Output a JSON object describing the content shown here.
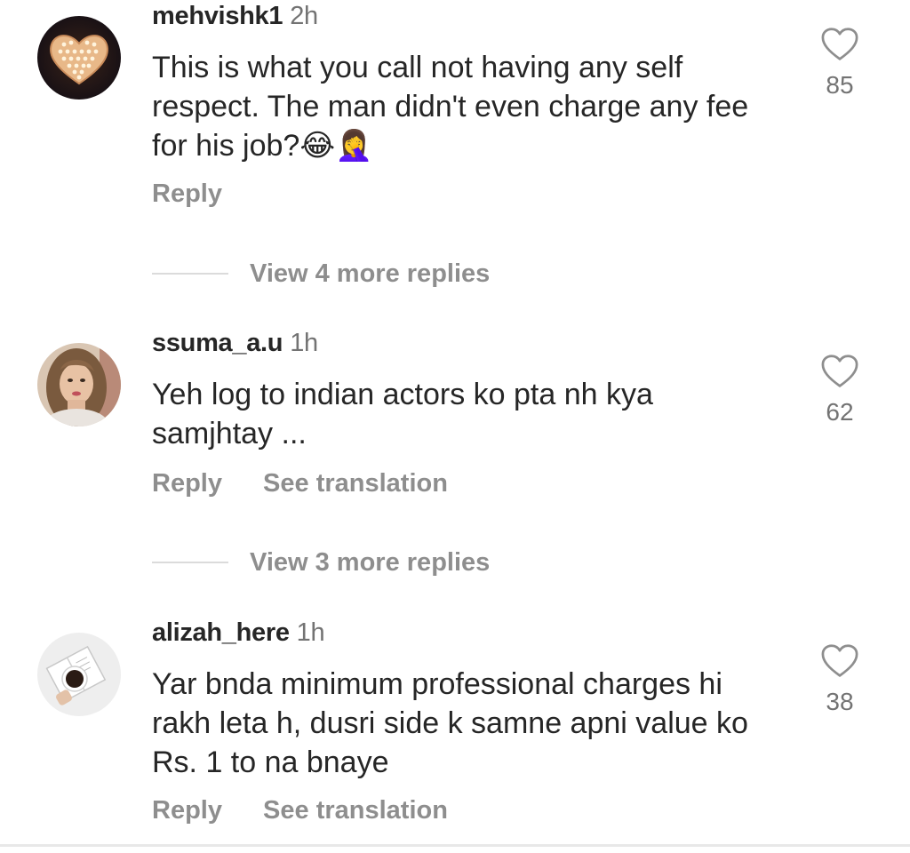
{
  "comments": [
    {
      "username": "mehvishk1",
      "time": "2h",
      "text": "This is what you call not having any self respect. The man didn't even charge any fee for his job?😂🤦‍♀️",
      "likes": "85",
      "actions": {
        "reply": "Reply"
      },
      "view_replies": "View 4 more replies",
      "avatar_icon": "heart-marquee-lights"
    },
    {
      "username": "ssuma_a.u",
      "time": "1h",
      "text": "Yeh log to indian actors ko pta nh kya samjhtay ...",
      "likes": "62",
      "actions": {
        "reply": "Reply",
        "translate": "See translation"
      },
      "view_replies": "View 3 more replies",
      "avatar_icon": "woman-portrait"
    },
    {
      "username": "alizah_here",
      "time": "1h",
      "text": "Yar bnda minimum professional charges hi rakh leta h, dusri side k samne apni value ko Rs. 1 to na bnaye",
      "likes": "38",
      "actions": {
        "reply": "Reply",
        "translate": "See translation"
      },
      "avatar_icon": "coffee-cup-notebook"
    }
  ],
  "icons": {
    "like": "heart-outline-icon"
  },
  "colors": {
    "text": "#262626",
    "secondary": "#8e8e8e",
    "meta": "#737373",
    "divider": "#dbdbdb"
  }
}
